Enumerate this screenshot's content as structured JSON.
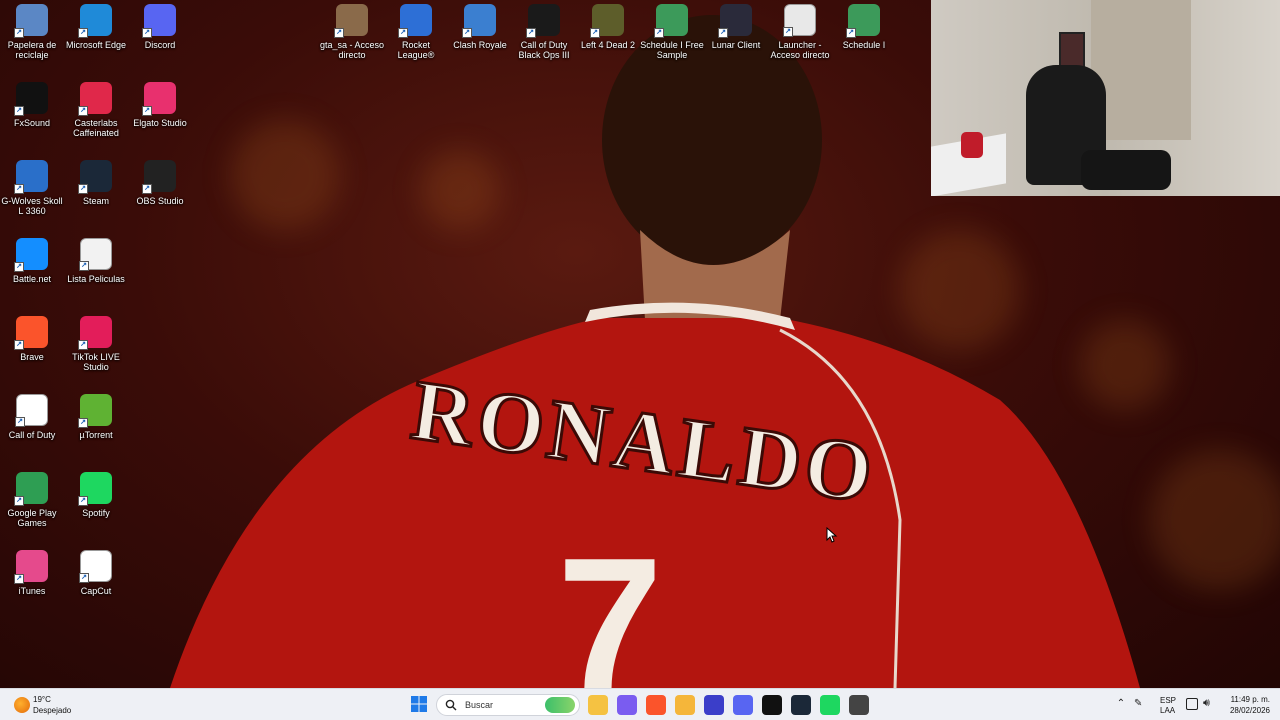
{
  "desktop": {
    "icons_left": [
      {
        "label": "Papelera de reciclaje",
        "icon": "recycle-bin-icon",
        "color": "#5b87c5"
      },
      {
        "label": "Microsoft Edge",
        "icon": "edge-icon",
        "color": "#1f8ad8"
      },
      {
        "label": "Discord",
        "icon": "discord-icon",
        "color": "#5865f2"
      },
      {
        "label": "FxSound",
        "icon": "fxsound-icon",
        "color": "#111111"
      },
      {
        "label": "Casterlabs Caffeinated",
        "icon": "casterlabs-icon",
        "color": "#e0284a"
      },
      {
        "label": "Elgato Studio",
        "icon": "elgato-icon",
        "color": "#e8306e"
      },
      {
        "label": "G-Wolves Skoll L 3360",
        "icon": "gwolves-icon",
        "color": "#2a6fc9"
      },
      {
        "label": "Steam",
        "icon": "steam-icon",
        "color": "#1b2838"
      },
      {
        "label": "OBS Studio",
        "icon": "obs-icon",
        "color": "#222222"
      },
      {
        "label": "Battle.net",
        "icon": "battlenet-icon",
        "color": "#148eff"
      },
      {
        "label": "Lista Peliculas",
        "icon": "document-icon",
        "color": "#f2f2f2"
      },
      {
        "label": "Brave",
        "icon": "brave-icon",
        "color": "#fb542b"
      },
      {
        "label": "TikTok LIVE Studio",
        "icon": "tiktok-icon",
        "color": "#e31d5a"
      },
      {
        "label": "Call of Duty",
        "icon": "blank-file-icon",
        "color": "#ffffff"
      },
      {
        "label": "µTorrent",
        "icon": "utorrent-icon",
        "color": "#5fb233"
      },
      {
        "label": "Google Play Games",
        "icon": "google-play-games-icon",
        "color": "#2e9e53"
      },
      {
        "label": "Spotify",
        "icon": "spotify-icon",
        "color": "#1ed760"
      },
      {
        "label": "iTunes",
        "icon": "itunes-icon",
        "color": "#e54a8c"
      },
      {
        "label": "CapCut",
        "icon": "capcut-icon",
        "color": "#ffffff"
      }
    ],
    "icons_top": [
      {
        "label": "gta_sa - Acceso directo",
        "icon": "gta-sa-icon",
        "color": "#8a6a4a"
      },
      {
        "label": "Rocket League®",
        "icon": "rocket-league-icon",
        "color": "#2d6fd6"
      },
      {
        "label": "Clash Royale",
        "icon": "clash-royale-icon",
        "color": "#3b7fd0"
      },
      {
        "label": "Call of Duty Black Ops III",
        "icon": "cod-bo3-icon",
        "color": "#1a1a1a"
      },
      {
        "label": "Left 4 Dead 2",
        "icon": "l4d2-icon",
        "color": "#5d5d2a"
      },
      {
        "label": "Schedule I Free Sample",
        "icon": "schedule-i-icon",
        "color": "#3c9a5a"
      },
      {
        "label": "Lunar Client",
        "icon": "lunar-client-icon",
        "color": "#2a2a3a"
      },
      {
        "label": "Launcher - Acceso directo",
        "icon": "launcher-icon",
        "color": "#e8e8e8"
      },
      {
        "label": "Schedule I",
        "icon": "schedule-i-icon",
        "color": "#3c9a5a"
      }
    ]
  },
  "wallpaper": {
    "jersey_name": "RONALDO",
    "jersey_number": "7",
    "jersey_color": "#b3150f"
  },
  "taskbar": {
    "weather_temp": "19°C",
    "weather_desc": "Despejado",
    "search_placeholder": "Buscar",
    "apps": [
      {
        "icon": "file-explorer-icon",
        "color": "#f5c242"
      },
      {
        "icon": "copilot-icon",
        "color": "#7a5cf0"
      },
      {
        "icon": "brave-icon",
        "color": "#fb542b"
      },
      {
        "icon": "folder-icon",
        "color": "#f5b63a"
      },
      {
        "icon": "cortana-icon",
        "color": "#3b3ec9"
      },
      {
        "icon": "discord-icon",
        "color": "#5865f2"
      },
      {
        "icon": "fxsound-icon",
        "color": "#111111"
      },
      {
        "icon": "steam-icon",
        "color": "#1b2838"
      },
      {
        "icon": "spotify-icon",
        "color": "#1ed760"
      },
      {
        "icon": "obs-icon",
        "color": "#444444"
      }
    ],
    "lang_primary": "ESP",
    "lang_secondary": "LAA",
    "time": "11:49 p. m.",
    "date": "28/02/2026"
  }
}
